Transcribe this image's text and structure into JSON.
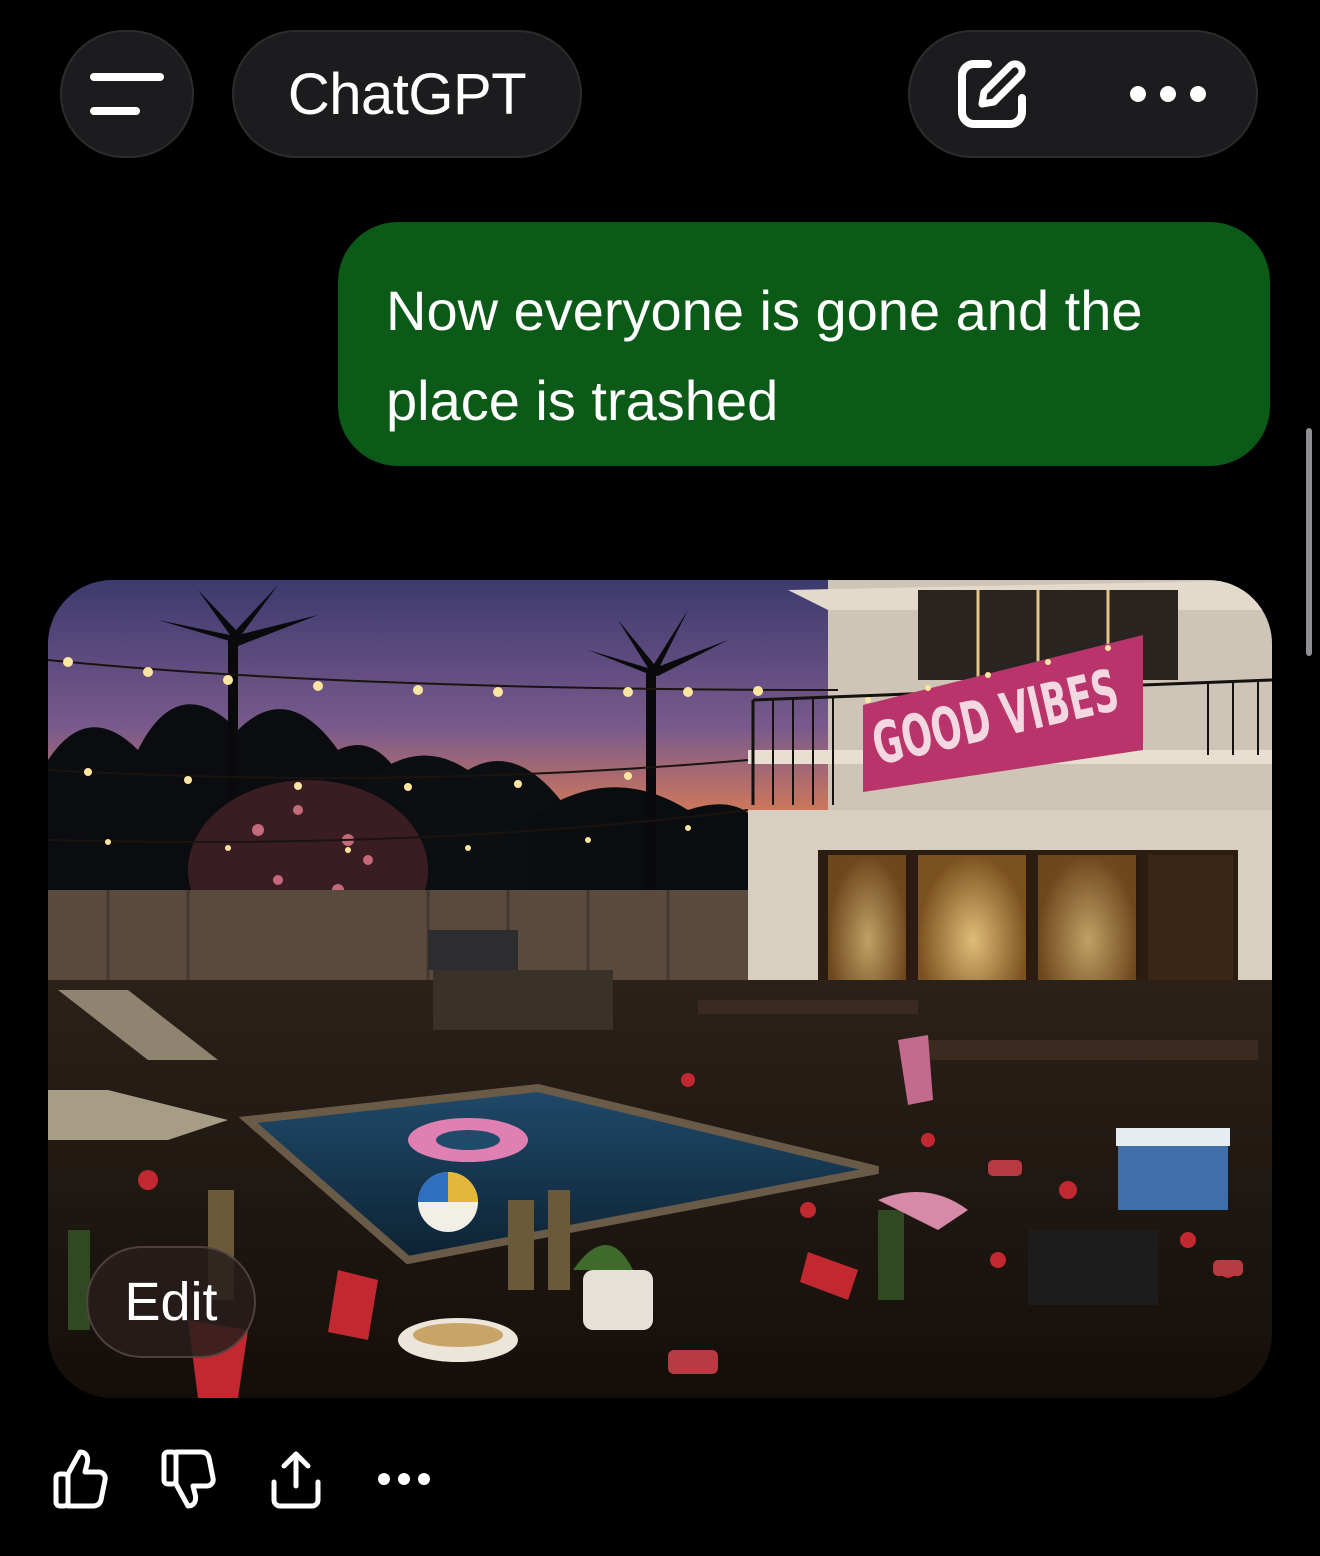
{
  "header": {
    "title": "ChatGPT",
    "menu_icon": "menu-icon",
    "new_chat_icon": "compose-icon",
    "more_icon": "more-icon"
  },
  "conversation": {
    "user_message": "Now everyone is gone and the place is trashed",
    "assistant_image": {
      "banner_text": "GOOD VIBES",
      "edit_label": "Edit"
    }
  },
  "message_actions": [
    {
      "name": "thumbs-up-icon"
    },
    {
      "name": "thumbs-down-icon"
    },
    {
      "name": "share-icon"
    },
    {
      "name": "more-icon"
    }
  ],
  "colors": {
    "background": "#000000",
    "user_bubble": "#0b5a17",
    "pill": "#1c1c1e",
    "text": "#ffffff"
  }
}
